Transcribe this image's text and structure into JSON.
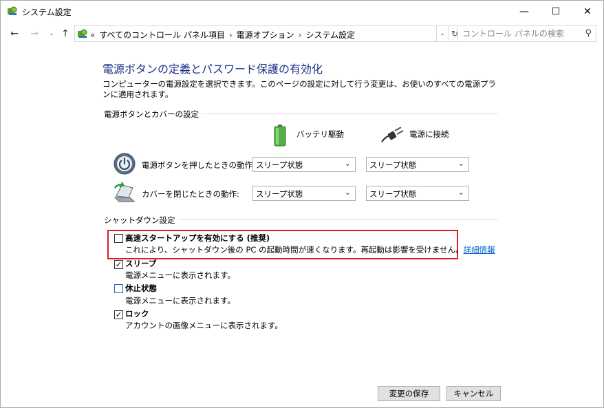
{
  "window": {
    "title": "システム設定",
    "minimize": "—",
    "maximize": "☐",
    "close": "✕"
  },
  "nav": {
    "back": "←",
    "forward": "→",
    "recent": "⌄",
    "up": "↑",
    "breadcrumb_overflow": "«",
    "breadcrumbs": [
      "すべてのコントロール パネル項目",
      "電源オプション",
      "システム設定"
    ],
    "separator": "›",
    "dropdown": "⌄",
    "refresh": "↻",
    "search_placeholder": "コントロール パネルの検索",
    "search_icon": "⚲"
  },
  "page": {
    "heading": "電源ボタンの定義とパスワード保護の有効化",
    "description": "コンピューターの電源設定を選択できます。このページの設定に対して行う変更は、お使いのすべての電源プランに適用されます。"
  },
  "power_section": {
    "label": "電源ボタンとカバーの設定",
    "col_battery": "バッテリ駆動",
    "col_plugged": "電源に接続",
    "rows": [
      {
        "label": "電源ボタンを押したときの動作:",
        "battery": "スリープ状態",
        "plugged": "スリープ状態"
      },
      {
        "label": "カバーを閉じたときの動作:",
        "battery": "スリープ状態",
        "plugged": "スリープ状態"
      }
    ],
    "dropdown_arrow": "⌄"
  },
  "shutdown_section": {
    "label": "シャットダウン設定",
    "options": [
      {
        "title": "高速スタートアップを有効にする (推奨)",
        "desc": "これにより、シャットダウン後の PC の起動時間が速くなります。再起動は影響を受けません。",
        "link": "詳細情報",
        "checked": false,
        "mark": ""
      },
      {
        "title": "スリープ",
        "desc": "電源メニューに表示されます。",
        "checked": true,
        "mark": "✓"
      },
      {
        "title": "休止状態",
        "desc": "電源メニューに表示されます。",
        "checked": false,
        "mark": ""
      },
      {
        "title": "ロック",
        "desc": "アカウントの画像メニューに表示されます。",
        "checked": true,
        "mark": "✓"
      }
    ],
    "highlight_color": "#e31b23"
  },
  "buttons": {
    "save": "変更の保存",
    "cancel": "キャンセル"
  }
}
